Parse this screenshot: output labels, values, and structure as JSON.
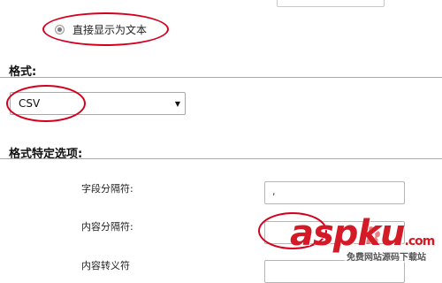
{
  "radio_option": {
    "label": "直接显示为文本",
    "checked": true
  },
  "format_section": {
    "title": "格式:",
    "selected_value": "CSV"
  },
  "format_options_section": {
    "title": "格式特定选项:",
    "fields": [
      {
        "label": "字段分隔符:",
        "value": ","
      },
      {
        "label": "内容分隔符:",
        "value": ""
      },
      {
        "label": "内容转义符",
        "value": ""
      }
    ]
  },
  "watermark": {
    "logo": "aspku",
    "logo_suffix": ".com",
    "tagline": "免费网站源码下载站"
  },
  "colors": {
    "annotation_red": "#d4001e",
    "watermark_red": "#d41a26"
  },
  "icons": {
    "select_arrow": "triangle-down"
  }
}
